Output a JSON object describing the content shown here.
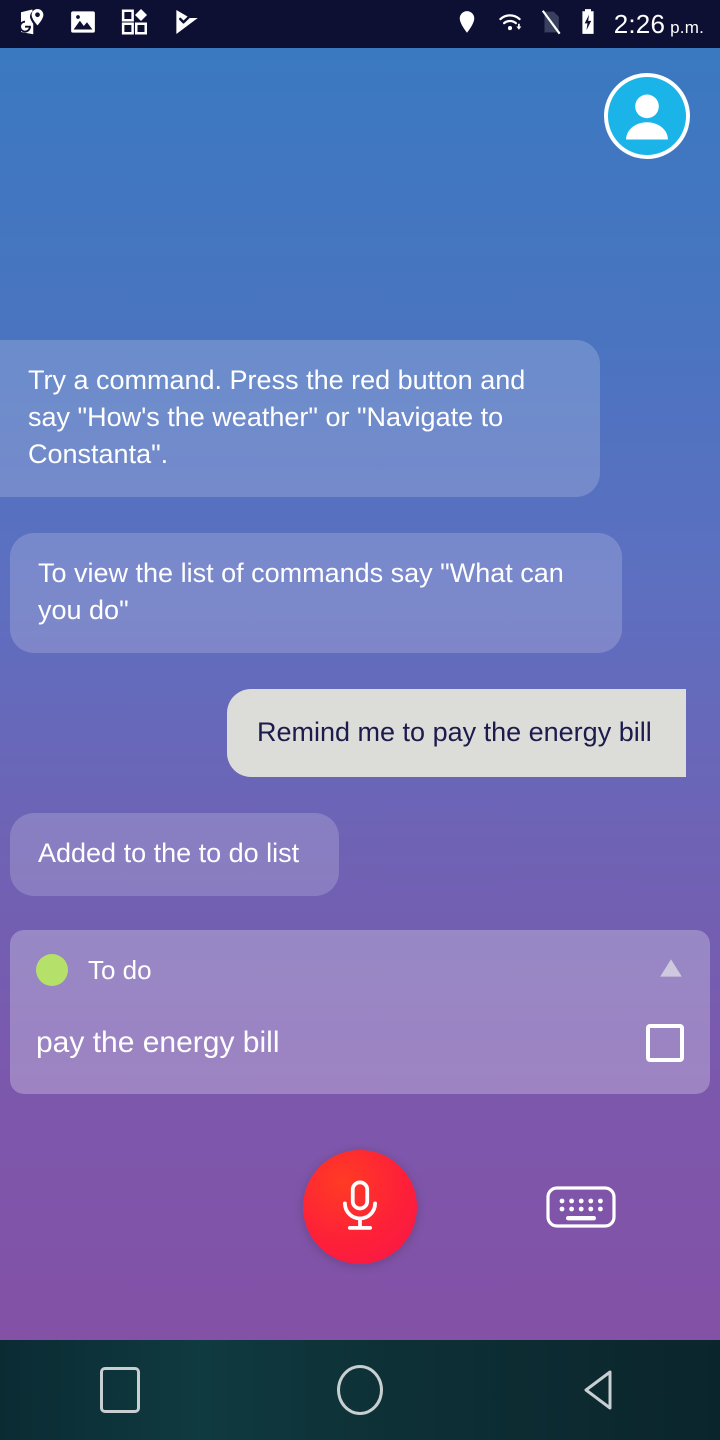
{
  "status_bar": {
    "background_color": "#0e1033",
    "notifications": [
      {
        "icon": "maps-icon",
        "label": "Maps"
      },
      {
        "icon": "photos-icon",
        "label": "Photos"
      },
      {
        "icon": "apps-grid-icon",
        "label": "Play Store"
      },
      {
        "icon": "tasks-check-icon",
        "label": "Tasks"
      }
    ],
    "system": [
      {
        "icon": "location-pin-icon",
        "label": "Location"
      },
      {
        "icon": "wifi-icon",
        "label": "Wi-Fi"
      },
      {
        "icon": "no-sim-icon",
        "label": "No SIM"
      },
      {
        "icon": "battery-charging-icon",
        "label": "Charging"
      }
    ],
    "time": "2:26",
    "ampm": "p.m."
  },
  "wallpaper": {
    "gradient_top": "#3a79c0",
    "gradient_bottom": "#8351a6"
  },
  "header": {
    "avatar": {
      "icon": "account-avatar-icon",
      "label": "Account",
      "bg_color": "#1bb4e8",
      "ring_color": "#ffffff"
    }
  },
  "chat": {
    "messages": [
      {
        "id": "bot-hint-1",
        "sender": "assistant",
        "text": "Try a command. Press the red button and say \"How's the weather\" or \"Navigate to Constanta\"."
      },
      {
        "id": "bot-hint-2",
        "sender": "assistant",
        "text": "To view the list of commands say \"What can you do\""
      },
      {
        "id": "user-request",
        "sender": "user",
        "text": "Remind me to pay the energy bill"
      },
      {
        "id": "bot-confirm",
        "sender": "assistant",
        "text": "Added to the to do list"
      }
    ],
    "bubble_color_assistant": "rgba(255,255,255,0.18)",
    "bubble_color_user": "#dcdcd8",
    "text_color_user": "#1b1b4d"
  },
  "todo_card": {
    "dot_color": "#b5e06a",
    "title": "To do",
    "collapse_icon": "triangle-up-icon",
    "items": [
      {
        "text": "pay the energy bill",
        "checked": false
      }
    ]
  },
  "controls": {
    "mic_button": {
      "icon": "microphone-icon",
      "label": "Voice command",
      "color": "#fd2038"
    },
    "keyboard_button": {
      "icon": "keyboard-icon",
      "label": "Type command"
    }
  },
  "nav_bar": {
    "buttons": [
      {
        "icon": "recents-square-icon",
        "label": "Recents"
      },
      {
        "icon": "home-circle-icon",
        "label": "Home"
      },
      {
        "icon": "back-triangle-icon",
        "label": "Back"
      }
    ]
  }
}
